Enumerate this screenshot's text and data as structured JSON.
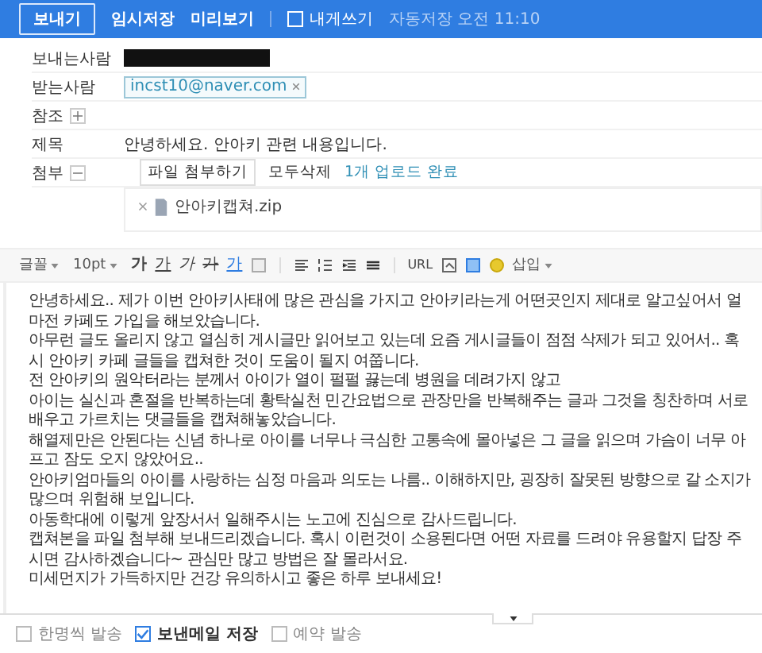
{
  "top_bar": {
    "send": "보내기",
    "actions": [
      "임시저장",
      "미리보기"
    ],
    "self_mail": {
      "label": "내게쓰기",
      "checked": false
    },
    "autosave": "자동저장 오전 11:10"
  },
  "fields": {
    "sender_label": "보내는사람",
    "sender_redacted": true,
    "to_label": "받는사람",
    "recipients": [
      "incst10@naver.com"
    ],
    "cc_label": "참조",
    "subject_label": "제목",
    "subject": "안녕하세요. 안아키 관련 내용입니다.",
    "attach_label": "첨부",
    "attach_button": "파일 첨부하기",
    "delete_all": "모두삭제",
    "upload_status": "1개 업로드 완료",
    "files": [
      "안아키캡쳐.zip"
    ]
  },
  "editor_toolbar": [
    {
      "kind": "dropdown",
      "text": "글꼴"
    },
    {
      "kind": "dropdown",
      "text": "10pt"
    },
    {
      "kind": "bold",
      "text": "가"
    },
    {
      "kind": "underline",
      "text": "가"
    },
    {
      "kind": "italic",
      "text": "가"
    },
    {
      "kind": "strike",
      "text": "가"
    },
    {
      "kind": "color",
      "text": "가"
    },
    {
      "kind": "box"
    },
    {
      "kind": "sep"
    },
    {
      "kind": "align"
    },
    {
      "kind": "list"
    },
    {
      "kind": "indent"
    },
    {
      "kind": "lines"
    },
    {
      "kind": "sep"
    },
    {
      "kind": "text",
      "text": "URL"
    },
    {
      "kind": "image"
    },
    {
      "kind": "square"
    },
    {
      "kind": "emoji"
    },
    {
      "kind": "dropdown",
      "text": "삽입"
    }
  ],
  "body": [
    "안녕하세요.. 제가 이번 안아키사태에 많은 관심을 가지고 안아키라는게 어떤곳인지 제대로 알고싶어서 얼마전 카페도 가입을 해보았습니다.",
    "아무런 글도 올리지 않고 열심히 게시글만 읽어보고 있는데 요즘 게시글들이 점점 삭제가 되고 있어서.. 혹시 안아키 카페 글들을 캡쳐한 것이 도움이 될지 여쭙니다.",
    "전 안아키의 원악터라는 분께서 아이가 열이 펄펄 끓는데 병원을 데려가지 않고",
    "아이는 실신과 혼절을 반복하는데 황탁실천 민간요법으로 관장만을 반복해주는 글과 그것을 칭찬하며 서로 배우고 가르치는 댓글들을 캡쳐해놓았습니다.",
    "해열제만은 안된다는 신념 하나로 아이를 너무나 극심한 고통속에 몰아넣은 그 글을 읽으며 가슴이 너무 아프고 잠도 오지 않았어요..",
    "안아키엄마들의 아이를 사랑하는 심정 마음과 의도는 나름.. 이해하지만, 굉장히 잘못된 방향으로 갈 소지가 많으며 위험해 보입니다.",
    "아동학대에 이렇게 앞장서서 일해주시는 노고에 진심으로 감사드립니다.",
    "캡쳐본을 파일 첨부해 보내드리겠습니다. 혹시 이런것이 소용된다면 어떤 자료를 드려야 유용할지 답장 주시면 감사하겠습니다~ 관심만 많고 방법은 잘 몰라서요.",
    "미세먼지가 가득하지만 건강 유의하시고 좋은 하루 보내세요!"
  ],
  "options": [
    {
      "label": "한명씩 발송",
      "checked": false
    },
    {
      "label": "보낸메일 저장",
      "checked": true
    },
    {
      "label": "예약 발송",
      "checked": false
    }
  ]
}
